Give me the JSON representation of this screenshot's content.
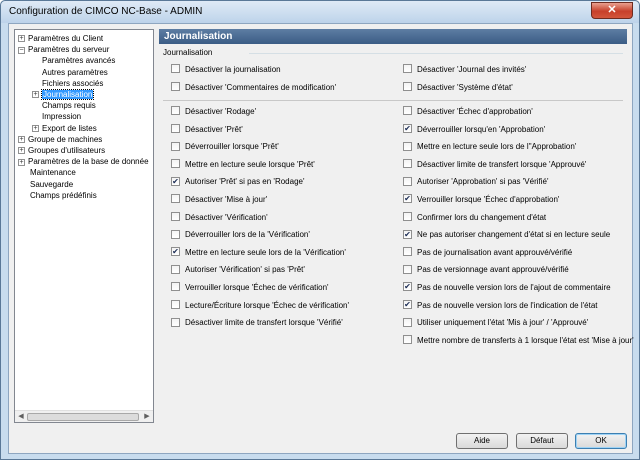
{
  "window": {
    "title": "Configuration de CIMCO NC-Base - ADMIN",
    "close_glyph": "✕"
  },
  "tree": {
    "items": [
      {
        "label": "Paramètres du Client",
        "level": 0,
        "expander": "+",
        "selected": false
      },
      {
        "label": "Paramètres du serveur",
        "level": 0,
        "expander": "−",
        "selected": false
      },
      {
        "label": "Paramètres avancés",
        "level": 1,
        "expander": "",
        "selected": false
      },
      {
        "label": "Autres paramètres",
        "level": 1,
        "expander": "",
        "selected": false
      },
      {
        "label": "Fichiers associés",
        "level": 1,
        "expander": "",
        "selected": false
      },
      {
        "label": "Journalisation",
        "level": 1,
        "expander": "+",
        "selected": true
      },
      {
        "label": "Champs requis",
        "level": 1,
        "expander": "",
        "selected": false
      },
      {
        "label": "Impression",
        "level": 1,
        "expander": "",
        "selected": false
      },
      {
        "label": "Export de listes",
        "level": 1,
        "expander": "+",
        "selected": false
      },
      {
        "label": "Groupe de machines",
        "level": 0,
        "expander": "+",
        "selected": false
      },
      {
        "label": "Groupes d'utilisateurs",
        "level": 0,
        "expander": "+",
        "selected": false
      },
      {
        "label": "Paramètres de la base de donnée",
        "level": 0,
        "expander": "+",
        "selected": false
      },
      {
        "label": "Maintenance",
        "level": 0,
        "expander": "",
        "selected": false
      },
      {
        "label": "Sauvegarde",
        "level": 0,
        "expander": "",
        "selected": false
      },
      {
        "label": "Champs prédéfinis",
        "level": 0,
        "expander": "",
        "selected": false
      }
    ],
    "scroll_left": "◀",
    "scroll_right": "▶"
  },
  "panel": {
    "header": "Journalisation",
    "group_label": "Journalisation",
    "top_left": [
      {
        "label": "Désactiver la journalisation",
        "checked": false
      },
      {
        "label": "Désactiver 'Commentaires de modification'",
        "checked": false
      }
    ],
    "top_right": [
      {
        "label": "Désactiver 'Journal des invités'",
        "checked": false
      },
      {
        "label": "Désactiver 'Système d'état'",
        "checked": false
      }
    ],
    "left": [
      {
        "label": "Désactiver 'Rodage'",
        "checked": false
      },
      {
        "label": "Désactiver 'Prêt'",
        "checked": false
      },
      {
        "label": "Déverrouiller lorsque 'Prêt'",
        "checked": false
      },
      {
        "label": "Mettre en lecture seule lorsque 'Prêt'",
        "checked": false
      },
      {
        "label": "Autoriser 'Prêt' si pas en 'Rodage'",
        "checked": true
      },
      {
        "label": "Désactiver 'Mise à jour'",
        "checked": false
      },
      {
        "label": "Désactiver 'Vérification'",
        "checked": false
      },
      {
        "label": "Déverrouiller lors de la 'Vérification'",
        "checked": false
      },
      {
        "label": "Mettre en lecture seule lors de la 'Vérification'",
        "checked": true
      },
      {
        "label": "Autoriser 'Vérification' si pas 'Prêt'",
        "checked": false
      },
      {
        "label": "Verrouiller lorsque 'Échec de vérification'",
        "checked": false
      },
      {
        "label": "Lecture/Écriture lorsque 'Échec de vérification'",
        "checked": false
      },
      {
        "label": "Désactiver limite de transfert lorsque 'Vérifié'",
        "checked": false
      }
    ],
    "right": [
      {
        "label": "Désactiver 'Échec d'approbation'",
        "checked": false
      },
      {
        "label": "Déverrouiller lorsqu'en 'Approbation'",
        "checked": true
      },
      {
        "label": "Mettre en lecture seule lors de l''Approbation'",
        "checked": false
      },
      {
        "label": "Désactiver limite de transfert lorsque 'Approuvé'",
        "checked": false
      },
      {
        "label": "Autoriser 'Approbation' si pas 'Vérifié'",
        "checked": false
      },
      {
        "label": "Verrouiller lorsque 'Échec d'approbation'",
        "checked": true
      },
      {
        "label": "Confirmer lors du changement d'état",
        "checked": false
      },
      {
        "label": "Ne pas autoriser changement d'état si en lecture seule",
        "checked": true
      },
      {
        "label": "Pas de journalisation avant approuvé/vérifié",
        "checked": false
      },
      {
        "label": "Pas de versionnage avant approuvé/vérifié",
        "checked": false
      },
      {
        "label": "Pas de nouvelle version lors de l'ajout de commentaire",
        "checked": true
      },
      {
        "label": "Pas de nouvelle version lors de l'indication de l'état",
        "checked": true
      },
      {
        "label": "Utiliser uniquement l'état 'Mis à jour' / 'Approuvé'",
        "checked": false
      },
      {
        "label": "Mettre nombre de transferts à 1 lorsque l'état est 'Mise à jour'",
        "checked": false
      }
    ]
  },
  "buttons": {
    "help": "Aide",
    "default": "Défaut",
    "ok": "OK"
  }
}
